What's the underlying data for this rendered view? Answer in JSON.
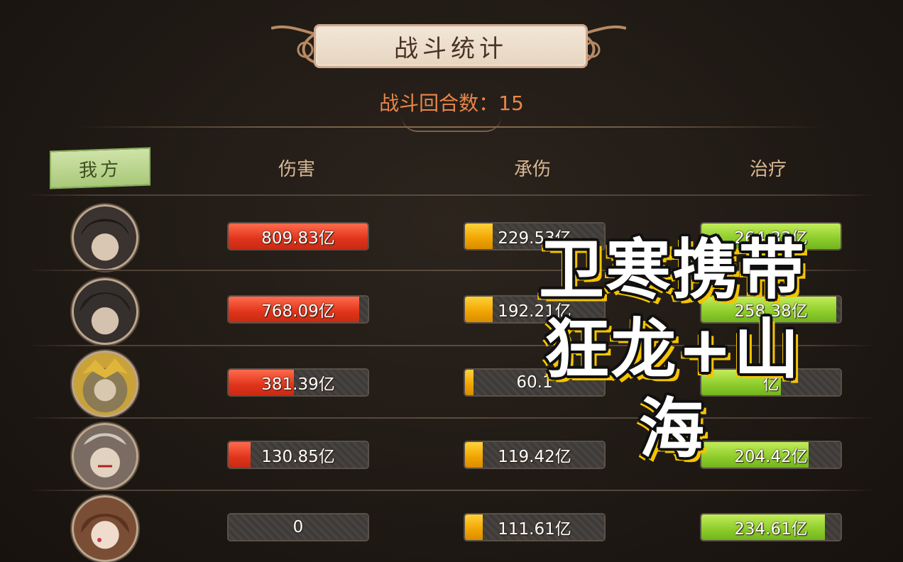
{
  "title": "战斗统计",
  "round_count_label": "战斗回合数：",
  "round_count": "15",
  "team_label": "我方",
  "columns": [
    "伤害",
    "承伤",
    "治疗"
  ],
  "colors": {
    "damage": "#e0341b",
    "taken": "#f0a400",
    "heal": "#8ccc2a",
    "round_text": "#e8854a"
  },
  "rows": [
    {
      "avatar": "hero-1-portrait",
      "damage": "809.83亿",
      "damage_pct": 1.0,
      "taken": "229.53亿",
      "taken_pct": 0.2,
      "heal": "264.33亿",
      "heal_pct": 1.0
    },
    {
      "avatar": "hero-2-portrait",
      "damage": "768.09亿",
      "damage_pct": 0.94,
      "taken": "192.21亿",
      "taken_pct": 0.2,
      "heal": "258.38亿",
      "heal_pct": 0.97
    },
    {
      "avatar": "hero-3-portrait",
      "damage": "381.39亿",
      "damage_pct": 0.47,
      "taken": "60.1",
      "taken_pct": 0.06,
      "heal": "亿",
      "heal_pct": 0.57
    },
    {
      "avatar": "hero-4-portrait",
      "damage": "130.85亿",
      "damage_pct": 0.16,
      "taken": "119.42亿",
      "taken_pct": 0.13,
      "heal": "204.42亿",
      "heal_pct": 0.77
    },
    {
      "avatar": "hero-5-portrait",
      "damage": "0",
      "damage_pct": 0.0,
      "taken": "111.61亿",
      "taken_pct": 0.13,
      "heal": "234.61亿",
      "heal_pct": 0.89
    }
  ],
  "overlay_caption": [
    "卫寒携带",
    "狂龙+山",
    "海"
  ]
}
